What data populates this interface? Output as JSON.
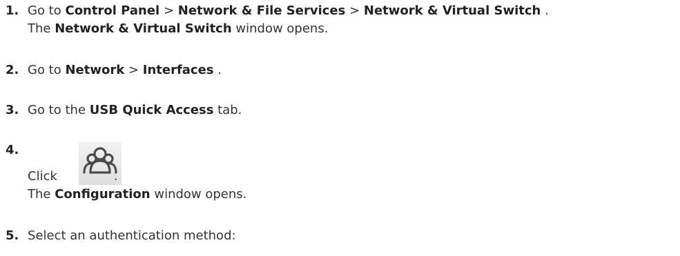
{
  "steps": [
    {
      "number": "1.",
      "line1": {
        "t1": "Go to ",
        "b1": "Control Panel",
        "t2": " > ",
        "b2": "Network & File Services",
        "t3": " > ",
        "b3": "Network & Virtual Switch",
        "t4": " ."
      },
      "line2": {
        "t1": "The ",
        "b1": "Network & Virtual Switch",
        "t2": " window opens."
      }
    },
    {
      "number": "2.",
      "line1": {
        "t1": "Go to ",
        "b1": "Network",
        "t2": " > ",
        "b2": "Interfaces",
        "t3": " ."
      }
    },
    {
      "number": "3.",
      "line1": {
        "t1": "Go to the ",
        "b1": "USB Quick Access",
        "t2": " tab."
      }
    },
    {
      "number": "4.",
      "click_text": "Click",
      "after_icon": ".",
      "icon": "users-group-icon",
      "line2": {
        "t1": "The ",
        "b1": "Configuration",
        "t2": " window opens."
      }
    },
    {
      "number": "5.",
      "line1": {
        "t1": "Select an authentication method:"
      }
    }
  ],
  "colors": {
    "text": "#333333",
    "bold": "#222222",
    "icon_bg": "#e6e6e6",
    "icon_stroke": "#4a4a4a"
  }
}
